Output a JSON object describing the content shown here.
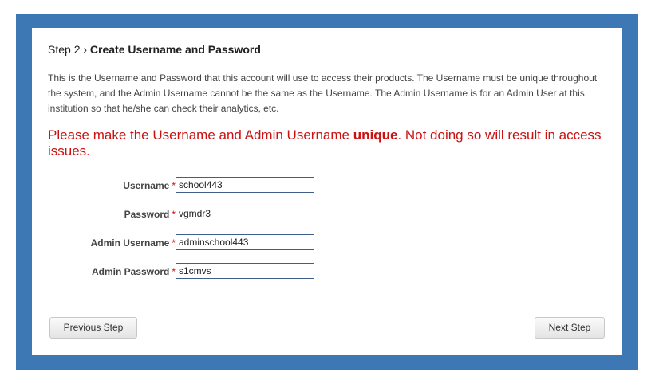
{
  "header": {
    "step_label": "Step 2 ›",
    "step_name": "Create Username and Password"
  },
  "description": "This is the Username and Password that this account will use to access their products. The Username must be unique throughout the system, and the Admin Username cannot be the same as the Username. The Admin Username is for an Admin User at this institution so that he/she can check their analytics, etc.",
  "warning": {
    "part1": "Please make the Username and Admin Username ",
    "emphasis": "unique",
    "part2": ". Not doing so will result in access issues."
  },
  "form": {
    "required_marker": "*",
    "username": {
      "label": "Username",
      "value": "school443"
    },
    "password": {
      "label": "Password",
      "value": "vgmdr3"
    },
    "admin_username": {
      "label": "Admin Username",
      "value": "adminschool443"
    },
    "admin_password": {
      "label": "Admin Password",
      "value": "s1cmvs"
    }
  },
  "buttons": {
    "previous": "Previous Step",
    "next": "Next Step"
  },
  "colors": {
    "frame": "#3d78b5",
    "warning": "#cc1111"
  }
}
